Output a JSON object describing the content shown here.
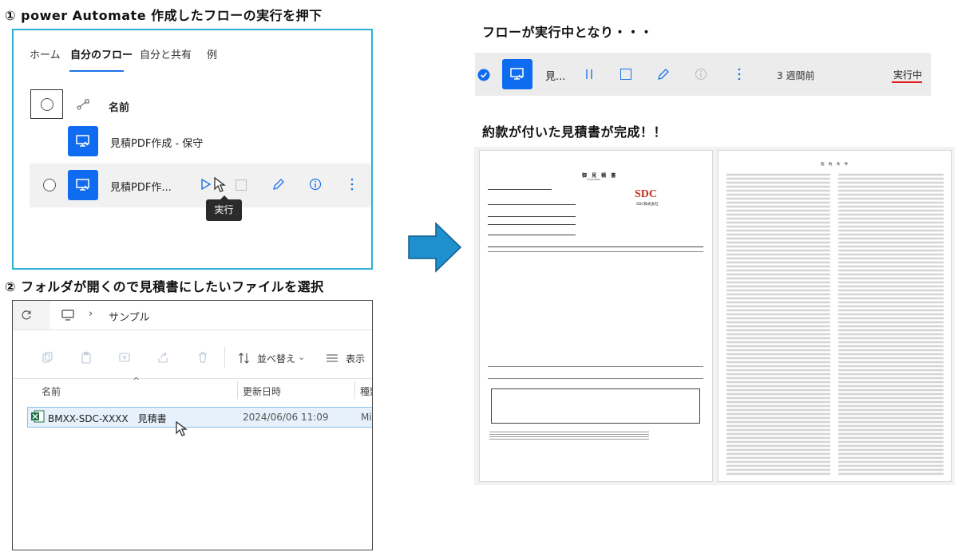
{
  "step1": {
    "heading": "① power Automate 作成したフローの実行を押下",
    "tabs": [
      "ホーム",
      "自分のフロー",
      "自分と共有",
      "例"
    ],
    "column_name": "名前",
    "flow_full_name": "見積PDF作成 - 保守",
    "flow_short_name": "見積PDF作...",
    "tooltip": "実行",
    "icons": [
      "checkbox-icon",
      "connector-icon",
      "flow-icon",
      "run-icon",
      "stop-icon",
      "edit-icon",
      "info-icon",
      "more-icon",
      "cursor-icon"
    ]
  },
  "step2": {
    "heading": "② フォルダが開くので見積書にしたいファイルを選択",
    "breadcrumb": "サンプル",
    "toolbar": {
      "sort_label": "並べ替え",
      "view_label": "表示"
    },
    "columns": [
      "名前",
      "更新日時",
      "種類"
    ],
    "file": {
      "name": "BMXX-SDC-XXXX　見積書",
      "modified": "2024/06/06 11:09",
      "type": "Mi"
    }
  },
  "step3": {
    "heading": "フローが実行中となり・・・",
    "flow_short": "見...",
    "age": "3 週間前",
    "status": "実行中",
    "status_underline_color": "#e02020"
  },
  "step4": {
    "heading": "約款が付いた見積書が完成！！",
    "quote_title": "御 見 積 書",
    "quote_subtitle": "Quotation",
    "logo": "SDC",
    "company": "SDC株式会社",
    "terms_title": "契 約 条 件"
  },
  "colors": {
    "accent": "#0f6cf0",
    "panel_border": "#2bb1d6",
    "arrow": "#1f8fce"
  }
}
